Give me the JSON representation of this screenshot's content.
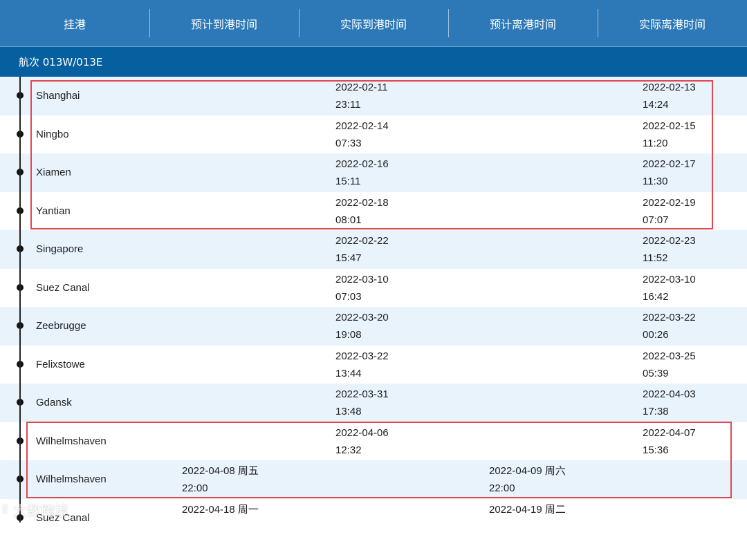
{
  "header": {
    "columns": [
      "挂港",
      "预计到港时间",
      "实际到港时间",
      "预计离港时间",
      "实际离港时间"
    ]
  },
  "voyage": {
    "label": "航次 013W/013E"
  },
  "rows": [
    {
      "port": "Shanghai",
      "eta": [
        "",
        ""
      ],
      "ata": [
        "2022-02-11",
        "23:11"
      ],
      "etd": [
        "",
        ""
      ],
      "atd": [
        "2022-02-13",
        "14:24"
      ]
    },
    {
      "port": "Ningbo",
      "eta": [
        "",
        ""
      ],
      "ata": [
        "2022-02-14",
        "07:33"
      ],
      "etd": [
        "",
        ""
      ],
      "atd": [
        "2022-02-15",
        "11:20"
      ]
    },
    {
      "port": "Xiamen",
      "eta": [
        "",
        ""
      ],
      "ata": [
        "2022-02-16",
        "15:11"
      ],
      "etd": [
        "",
        ""
      ],
      "atd": [
        "2022-02-17",
        "11:30"
      ]
    },
    {
      "port": "Yantian",
      "eta": [
        "",
        ""
      ],
      "ata": [
        "2022-02-18",
        "08:01"
      ],
      "etd": [
        "",
        ""
      ],
      "atd": [
        "2022-02-19",
        "07:07"
      ]
    },
    {
      "port": "Singapore",
      "eta": [
        "",
        ""
      ],
      "ata": [
        "2022-02-22",
        "15:47"
      ],
      "etd": [
        "",
        ""
      ],
      "atd": [
        "2022-02-23",
        "11:52"
      ]
    },
    {
      "port": "Suez Canal",
      "eta": [
        "",
        ""
      ],
      "ata": [
        "2022-03-10",
        "07:03"
      ],
      "etd": [
        "",
        ""
      ],
      "atd": [
        "2022-03-10",
        "16:42"
      ]
    },
    {
      "port": "Zeebrugge",
      "eta": [
        "",
        ""
      ],
      "ata": [
        "2022-03-20",
        "19:08"
      ],
      "etd": [
        "",
        ""
      ],
      "atd": [
        "2022-03-22",
        "00:26"
      ]
    },
    {
      "port": "Felixstowe",
      "eta": [
        "",
        ""
      ],
      "ata": [
        "2022-03-22",
        "13:44"
      ],
      "etd": [
        "",
        ""
      ],
      "atd": [
        "2022-03-25",
        "05:39"
      ]
    },
    {
      "port": "Gdansk",
      "eta": [
        "",
        ""
      ],
      "ata": [
        "2022-03-31",
        "13:48"
      ],
      "etd": [
        "",
        ""
      ],
      "atd": [
        "2022-04-03",
        "17:38"
      ]
    },
    {
      "port": "Wilhelmshaven",
      "eta": [
        "",
        ""
      ],
      "ata": [
        "2022-04-06",
        "12:32"
      ],
      "etd": [
        "",
        ""
      ],
      "atd": [
        "2022-04-07",
        "15:36"
      ]
    },
    {
      "port": "Wilhelmshaven",
      "eta": [
        "2022-04-08 周五",
        "22:00"
      ],
      "ata": [
        "",
        ""
      ],
      "etd": [
        "2022-04-09 周六",
        "22:00"
      ],
      "atd": [
        "",
        ""
      ]
    },
    {
      "port": "Suez Canal",
      "eta": [
        "2022-04-18 周一",
        ""
      ],
      "ata": [
        "",
        ""
      ],
      "etd": [
        "2022-04-19 周二",
        ""
      ],
      "atd": [
        "",
        ""
      ]
    }
  ],
  "watermark": {
    "icon": "hand-sign-icon",
    "text": "大数跨境"
  },
  "colors": {
    "header_bg": "#2d79b7",
    "voyage_bg": "#065f9e",
    "row_alt": "#e9f3fc",
    "highlight": "#e2474f"
  }
}
